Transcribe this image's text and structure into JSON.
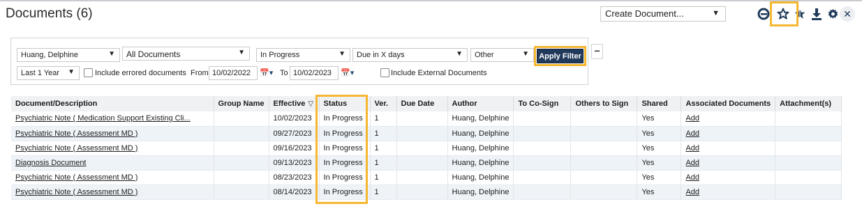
{
  "header": {
    "title": "Documents (6)",
    "create_doc": "Create Document..."
  },
  "toolbar_icons": [
    "user-icon",
    "star-icon",
    "star-half-icon",
    "download-icon",
    "gear-icon",
    "close-icon"
  ],
  "filters": {
    "staff": "Huang, Delphine",
    "doc_type": "All Documents",
    "status": "In Progress",
    "due": "Due in X days",
    "other": "Other",
    "apply_label": "Apply Filter",
    "period": "Last 1 Year",
    "include_errored": "Include errored documents",
    "from_label": "From",
    "from_date": "10/02/2022",
    "to_label": "To",
    "to_date": "10/02/2023",
    "include_external": "Include External Documents",
    "collapse": "–"
  },
  "table": {
    "columns": [
      "Document/Description",
      "Group Name",
      "Effective",
      "Status",
      "Ver.",
      "Due Date",
      "Author",
      "To Co-Sign",
      "Others to Sign",
      "Shared",
      "Associated Documents",
      "Attachment(s)"
    ],
    "rows": [
      {
        "doc": "Psychiatric Note ( Medication Support Existing Cli...",
        "group": "",
        "effective": "10/02/2023",
        "status": "In Progress",
        "ver": "1",
        "due": "",
        "author": "Huang, Delphine",
        "cosign": "",
        "others": "",
        "shared": "Yes",
        "assoc": "Add",
        "attach": ""
      },
      {
        "doc": "Psychiatric Note ( Assessment MD )",
        "group": "",
        "effective": "09/27/2023",
        "status": "In Progress",
        "ver": "1",
        "due": "",
        "author": "Huang, Delphine",
        "cosign": "",
        "others": "",
        "shared": "Yes",
        "assoc": "Add",
        "attach": ""
      },
      {
        "doc": "Psychiatric Note ( Assessment MD )",
        "group": "",
        "effective": "09/16/2023",
        "status": "In Progress",
        "ver": "1",
        "due": "",
        "author": "Huang, Delphine",
        "cosign": "",
        "others": "",
        "shared": "Yes",
        "assoc": "Add",
        "attach": ""
      },
      {
        "doc": "Diagnosis Document",
        "group": "",
        "effective": "09/13/2023",
        "status": "In Progress",
        "ver": "1",
        "due": "",
        "author": "Huang, Delphine",
        "cosign": "",
        "others": "",
        "shared": "Yes",
        "assoc": "Add",
        "attach": ""
      },
      {
        "doc": "Psychiatric Note ( Assessment MD )",
        "group": "",
        "effective": "08/23/2023",
        "status": "In Progress",
        "ver": "1",
        "due": "",
        "author": "Huang, Delphine",
        "cosign": "",
        "others": "",
        "shared": "Yes",
        "assoc": "Add",
        "attach": ""
      },
      {
        "doc": "Psychiatric Note ( Assessment MD )",
        "group": "",
        "effective": "08/14/2023",
        "status": "In Progress",
        "ver": "1",
        "due": "",
        "author": "Huang, Delphine",
        "cosign": "",
        "others": "",
        "shared": "Yes",
        "assoc": "Add",
        "attach": ""
      }
    ]
  },
  "colors": {
    "highlight": "#f5b731",
    "apply_bg": "#213a5c",
    "row_alt": "#eef3f8"
  }
}
